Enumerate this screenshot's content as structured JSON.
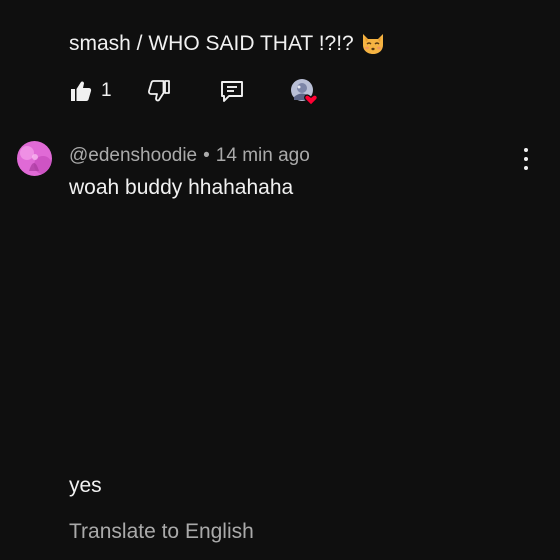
{
  "previous_comment": {
    "text": "smash / WHO SAID THAT !?!?",
    "emoji": "kissing-cat-emoji",
    "like_count": "1"
  },
  "comment": {
    "author": "@edenshoodie",
    "separator": "•",
    "timestamp": "14 min ago",
    "text": "woah buddy hhahahaha",
    "reply_text": "yes",
    "translate_label": "Translate to English"
  },
  "colors": {
    "background": "#0f0f0f",
    "primary_text": "#f1f1f1",
    "secondary_text": "#aaaaaa",
    "heart": "#ff0033",
    "avatar_pink": "#e06ad6"
  },
  "icons": [
    "thumbs-up-icon",
    "thumbs-down-icon",
    "reply-icon",
    "creator-heart-icon",
    "more-vert-icon"
  ]
}
